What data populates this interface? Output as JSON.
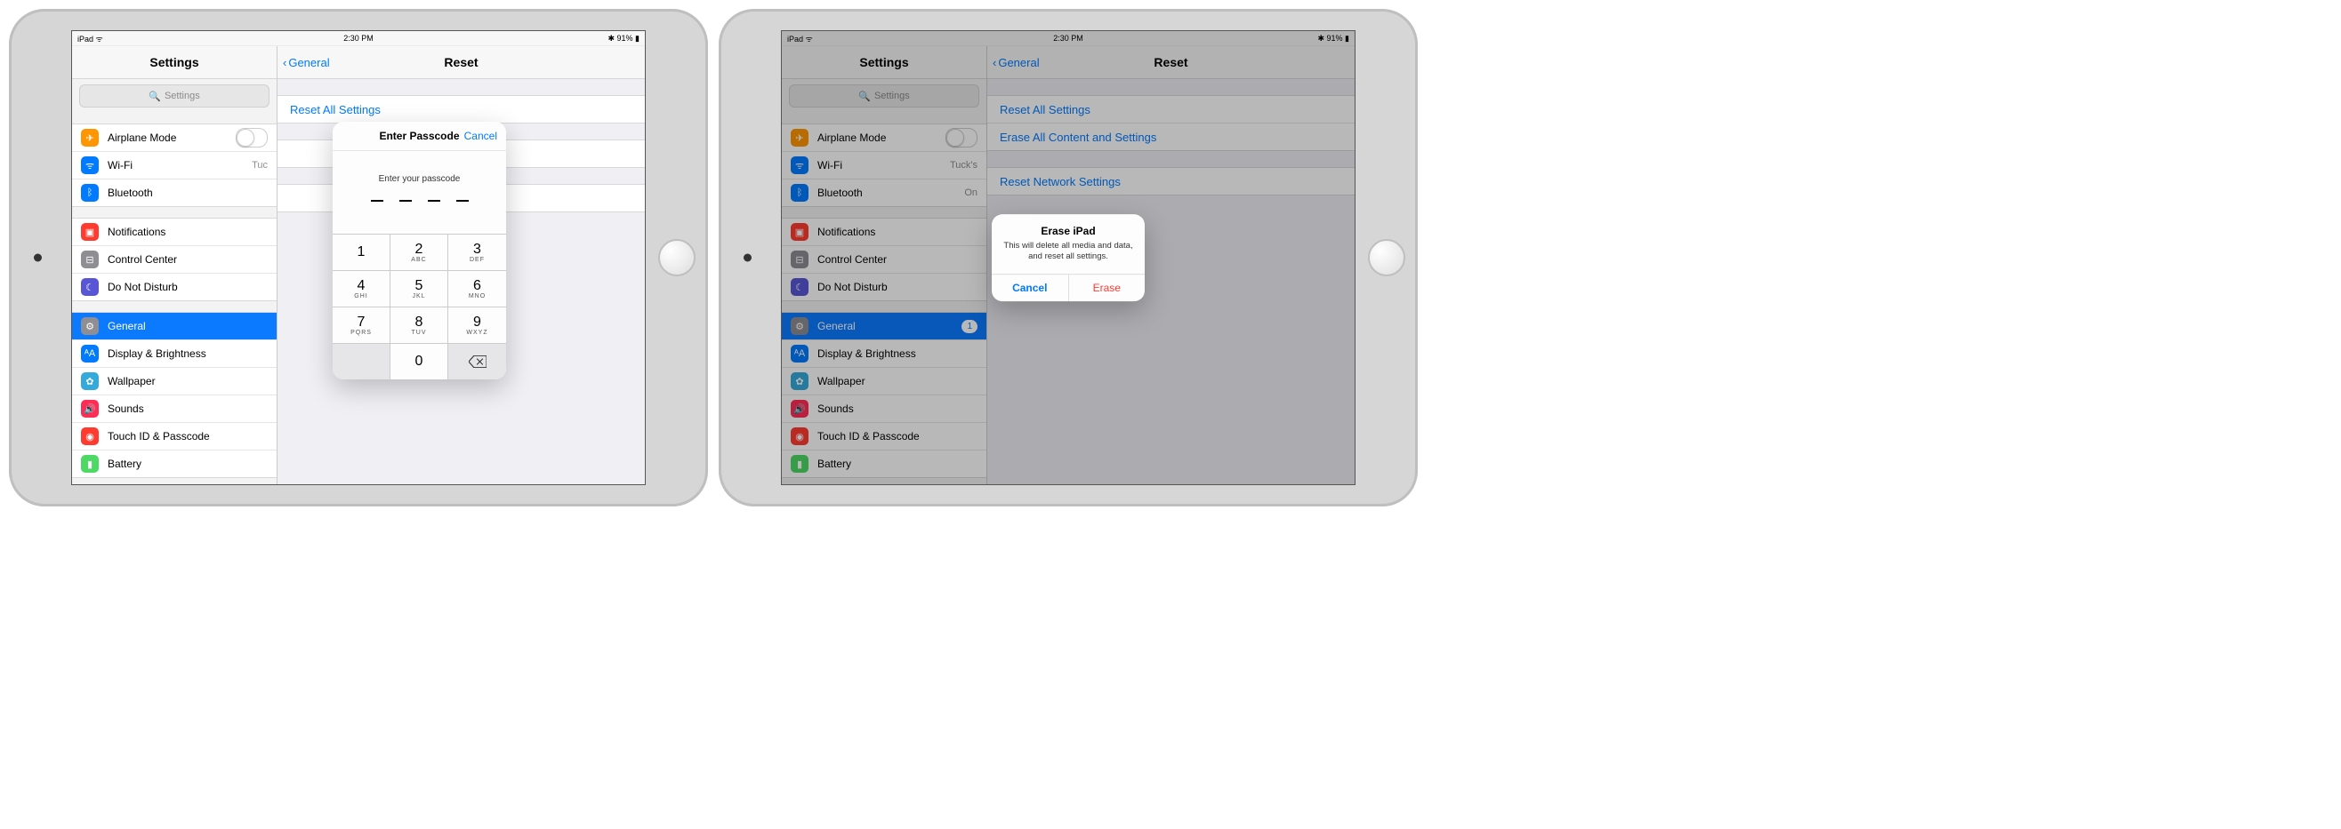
{
  "status": {
    "left": "iPad",
    "time": "2:30 PM",
    "battery": "91%"
  },
  "sidebar": {
    "title": "Settings",
    "search_placeholder": "Settings",
    "g1": [
      {
        "label": "Airplane Mode",
        "value": ""
      },
      {
        "label": "Wi-Fi",
        "value": "Tuck's",
        "value_trunc": "Tuc"
      },
      {
        "label": "Bluetooth",
        "value": "On"
      }
    ],
    "g2": [
      {
        "label": "Notifications"
      },
      {
        "label": "Control Center"
      },
      {
        "label": "Do Not Disturb"
      }
    ],
    "g3": [
      {
        "label": "General",
        "badge": "1"
      },
      {
        "label": "Display & Brightness"
      },
      {
        "label": "Wallpaper"
      },
      {
        "label": "Sounds"
      },
      {
        "label": "Touch ID & Passcode"
      },
      {
        "label": "Battery"
      }
    ]
  },
  "detail": {
    "back": "General",
    "title": "Reset",
    "rows1": [
      "Reset All Settings",
      "Erase All Content and Settings"
    ],
    "rows2": [
      "Reset Network Settings"
    ]
  },
  "left_detail_rows1": [
    "Reset All Settings"
  ],
  "passcode": {
    "title": "Enter Passcode",
    "cancel": "Cancel",
    "prompt": "Enter your passcode",
    "keys": [
      {
        "d": "1",
        "l": ""
      },
      {
        "d": "2",
        "l": "ABC"
      },
      {
        "d": "3",
        "l": "DEF"
      },
      {
        "d": "4",
        "l": "GHI"
      },
      {
        "d": "5",
        "l": "JKL"
      },
      {
        "d": "6",
        "l": "MNO"
      },
      {
        "d": "7",
        "l": "PQRS"
      },
      {
        "d": "8",
        "l": "TUV"
      },
      {
        "d": "9",
        "l": "WXYZ"
      },
      {
        "d": "",
        "l": ""
      },
      {
        "d": "0",
        "l": ""
      },
      {
        "d": "⌫",
        "l": ""
      }
    ]
  },
  "alert": {
    "title": "Erase iPad",
    "message": "This will delete all media and data, and reset all settings.",
    "cancel": "Cancel",
    "erase": "Erase"
  }
}
